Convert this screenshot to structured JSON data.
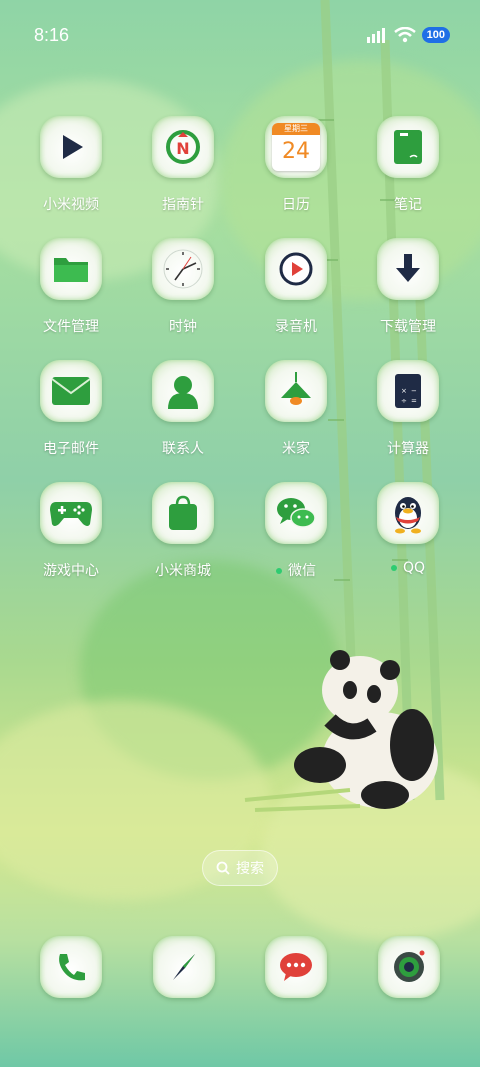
{
  "status_bar": {
    "time": "8:16",
    "battery": "100",
    "icons": [
      "signal-icon",
      "wifi-icon",
      "battery-icon"
    ]
  },
  "apps": [
    {
      "label": "小米视频",
      "icon": "play-icon"
    },
    {
      "label": "指南针",
      "icon": "compass-n-icon"
    },
    {
      "label": "日历",
      "icon": "calendar-icon",
      "calendar_day": "24",
      "calendar_header": "星期三"
    },
    {
      "label": "笔记",
      "icon": "notebook-icon"
    },
    {
      "label": "文件管理",
      "icon": "folder-icon"
    },
    {
      "label": "时钟",
      "icon": "clock-icon"
    },
    {
      "label": "录音机",
      "icon": "recorder-icon"
    },
    {
      "label": "下载管理",
      "icon": "download-icon"
    },
    {
      "label": "电子邮件",
      "icon": "mail-icon"
    },
    {
      "label": "联系人",
      "icon": "contact-icon"
    },
    {
      "label": "米家",
      "icon": "lamp-icon"
    },
    {
      "label": "计算器",
      "icon": "calculator-icon"
    },
    {
      "label": "游戏中心",
      "icon": "gamepad-icon"
    },
    {
      "label": "小米商城",
      "icon": "shopping-bag-icon"
    },
    {
      "label": "微信",
      "icon": "wechat-icon",
      "has_dot": true
    },
    {
      "label": "QQ",
      "icon": "qq-penguin-icon",
      "has_dot": true
    }
  ],
  "search": {
    "label": "搜索"
  },
  "dock": [
    {
      "icon": "phone-icon"
    },
    {
      "icon": "browser-compass-icon"
    },
    {
      "icon": "messages-icon"
    },
    {
      "icon": "camera-icon"
    }
  ],
  "colors": {
    "icon_green": "#2e9e3e",
    "dark_navy": "#1f2b45",
    "accent_red": "#e0413a",
    "accent_orange": "#f08a24",
    "battery_blue": "#1f6fe6"
  }
}
